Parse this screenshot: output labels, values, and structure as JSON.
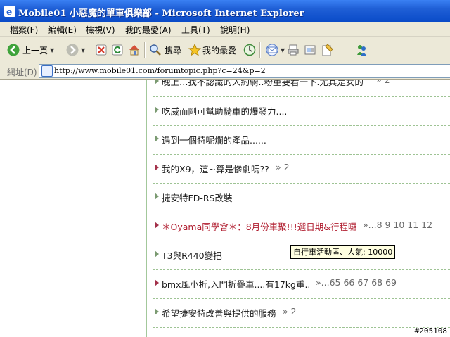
{
  "window": {
    "title": "Mobile01 小惡魔的單車俱樂部 - Microsoft Internet Explorer"
  },
  "menu": [
    {
      "label": "檔案(F)"
    },
    {
      "label": "編輯(E)"
    },
    {
      "label": "檢視(V)"
    },
    {
      "label": "我的最愛(A)"
    },
    {
      "label": "工具(T)"
    },
    {
      "label": "說明(H)"
    }
  ],
  "toolbar": {
    "back_label": "上一頁",
    "search_label": "搜尋",
    "favorites_label": "我的最愛"
  },
  "address": {
    "label": "網址(D)",
    "url": "http://www.mobile01.com/forumtopic.php?c=24&p=2"
  },
  "topics": [
    {
      "title": "晚上…找不認識的人約騎..粉重要看一下.尤其是女的",
      "pages": "» 2",
      "hot": false
    },
    {
      "title": "吃威而剛可幫助騎車的爆發力....",
      "pages": "",
      "hot": false
    },
    {
      "title": "遇到一個特呢爛的產品......",
      "pages": "",
      "hot": false
    },
    {
      "title": "我的X9，這~算是慘劇嗎??",
      "pages": "» 2",
      "hot": true
    },
    {
      "title": "捷安特FD-RS改裝",
      "pages": "",
      "hot": false
    },
    {
      "title": "＊Oyama同學會＊：8月份車聚!!!選日期&行程囉",
      "pages": "»...8 9 10 11 12",
      "hot": true,
      "highlight": true
    },
    {
      "title": "T3與R440變把",
      "pages": "",
      "hot": false
    },
    {
      "title": "bmx風小折,入門折疊車....有17kg重..",
      "pages": "»...65 66 67 68 69",
      "hot": true
    },
    {
      "title": "希望捷安特改善與提供的服務",
      "pages": "» 2",
      "hot": false
    }
  ],
  "tooltip": "自行車活動區、人氣: 10000",
  "watermark": "#205108",
  "colors": {
    "titlebar": "#0a4bc8",
    "hot_link": "#b01c2e",
    "divider": "#9ec394"
  }
}
